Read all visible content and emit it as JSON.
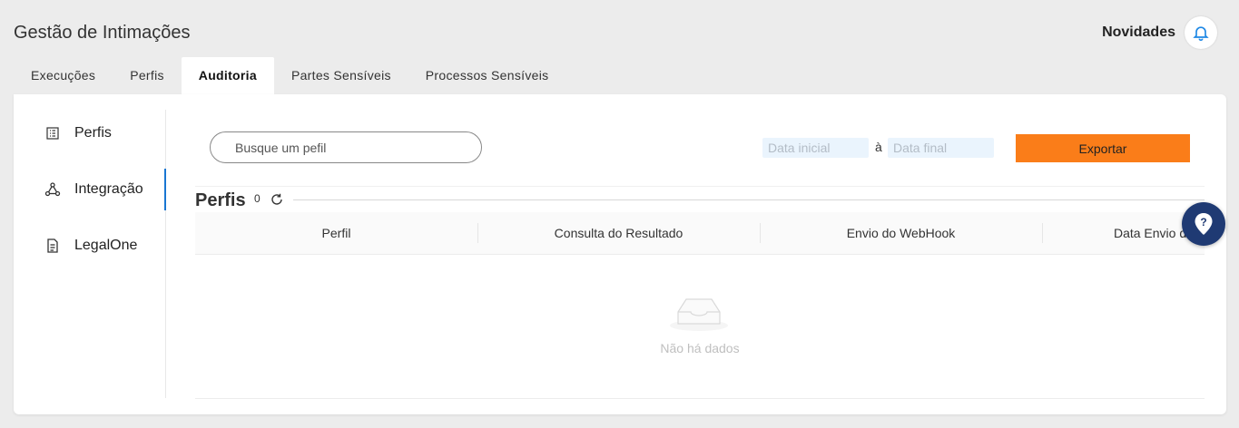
{
  "header": {
    "title": "Gestão de Intimações",
    "novidades_label": "Novidades",
    "bell_icon": "bell-icon"
  },
  "tabs": [
    {
      "label": "Execuções",
      "active": false
    },
    {
      "label": "Perfis",
      "active": false
    },
    {
      "label": "Auditoria",
      "active": true
    },
    {
      "label": "Partes Sensíveis",
      "active": false
    },
    {
      "label": "Processos Sensíveis",
      "active": false
    }
  ],
  "sidebar": {
    "items": [
      {
        "label": "Perfis",
        "icon": "list-icon",
        "active": false
      },
      {
        "label": "Integração",
        "icon": "integration-icon",
        "active": true
      },
      {
        "label": "LegalOne",
        "icon": "document-icon",
        "active": false
      }
    ]
  },
  "filters": {
    "search_placeholder": "Busque um pefil",
    "date_start_placeholder": "Data inicial",
    "date_separator": "à",
    "date_end_placeholder": "Data final",
    "export_label": "Exportar"
  },
  "section": {
    "title": "Perfis",
    "count": "0",
    "refresh_icon": "refresh-icon"
  },
  "table": {
    "columns": [
      "Perfil",
      "Consulta do Resultado",
      "Envio do WebHook",
      "Data Envio do WebHook"
    ],
    "rows": [],
    "empty_text": "Não há dados"
  },
  "colors": {
    "accent": "#fa7d19",
    "active_indicator": "#1976d2",
    "help_button": "#1f3a73",
    "date_input_bg": "#eaf4fd"
  }
}
